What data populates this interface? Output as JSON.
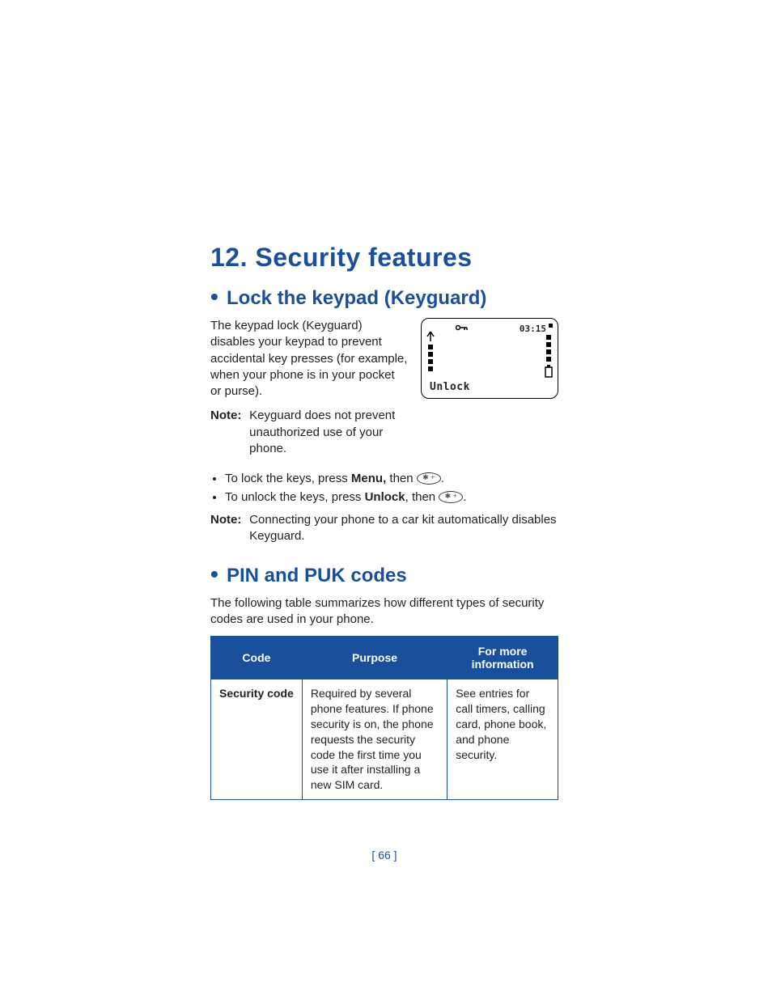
{
  "chapter": {
    "number": "12.",
    "title": "Security features"
  },
  "section1": {
    "heading": "Lock the keypad (Keyguard)",
    "intro": "The keypad lock (Keyguard) disables your keypad to prevent accidental key presses (for example, when your phone is in your pocket or purse).",
    "note1_label": "Note:",
    "note1": "Keyguard does not prevent unauthorized use of your phone.",
    "bullet1_a": "To lock the keys, press ",
    "bullet1_b": "Menu,",
    "bullet1_c": " then ",
    "bullet2_a": "To unlock the keys, press ",
    "bullet2_b": "Unlock",
    "bullet2_c": ", then ",
    "note2_label": "Note:",
    "note2": "Connecting your phone to a car kit automatically disables Keyguard.",
    "key_glyph": "✱ +"
  },
  "phone": {
    "time": "03:15",
    "softkey": "Unlock",
    "key_icon": "⚿"
  },
  "section2": {
    "heading": "PIN and PUK codes",
    "intro": "The following table summarizes how different types of security codes are used in your phone."
  },
  "table": {
    "headers": {
      "code": "Code",
      "purpose": "Purpose",
      "info": "For more information"
    },
    "rows": [
      {
        "code": "Security code",
        "purpose": "Required by several phone features. If phone security is on, the phone requests the security code the first time you use it after installing a new SIM card.",
        "info": "See entries for call timers, calling card, phone book, and phone security."
      }
    ]
  },
  "page_number": "[ 66 ]"
}
